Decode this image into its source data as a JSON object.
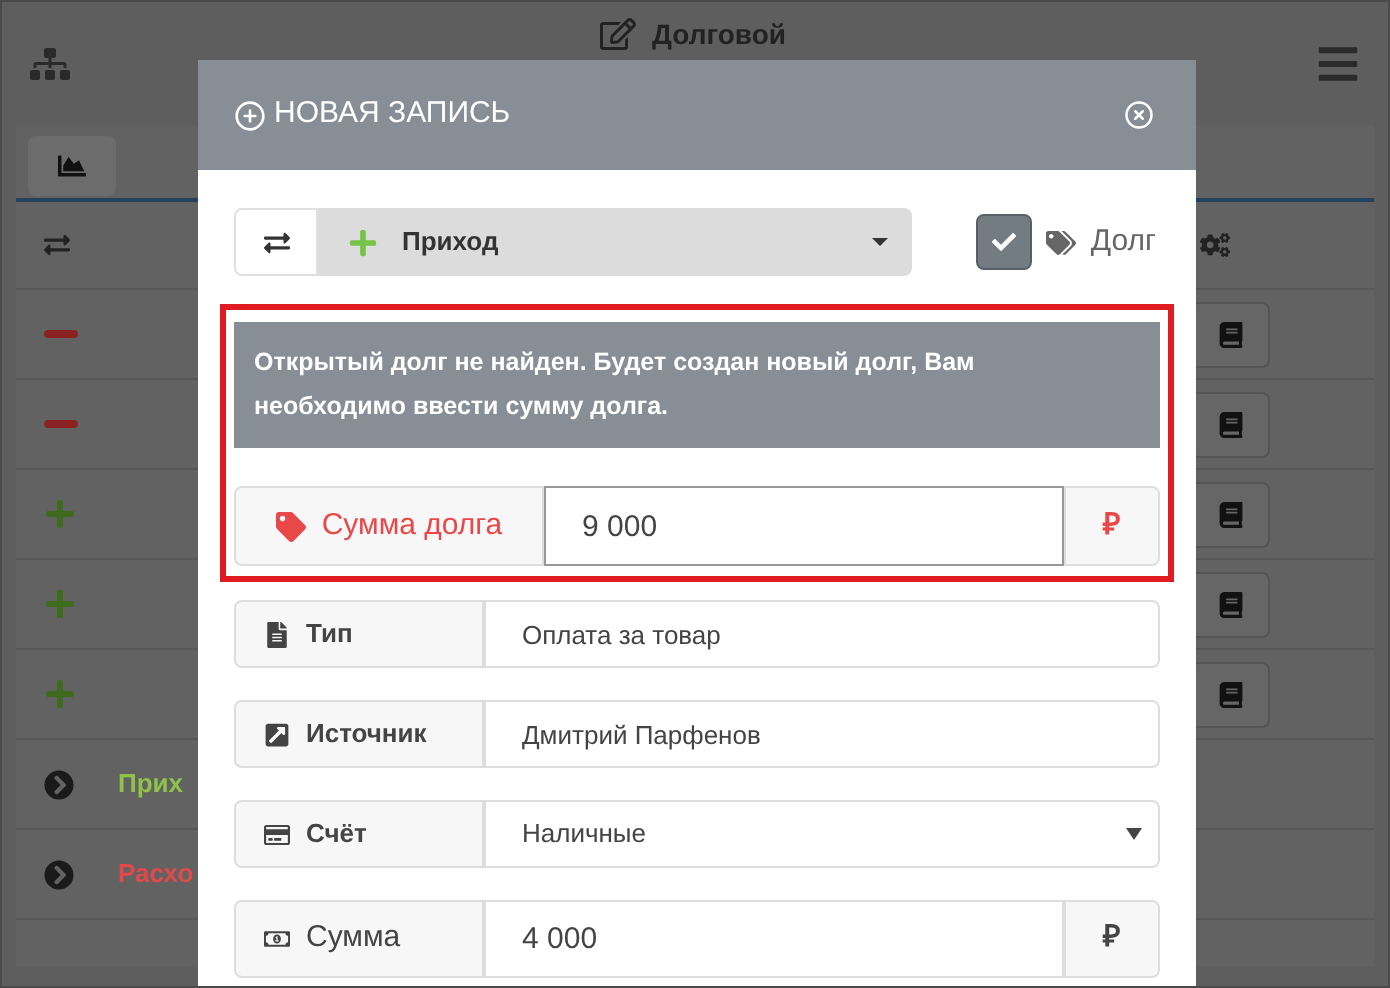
{
  "background": {
    "header_title": "Долговой",
    "rows": [
      {
        "kind": "minus"
      },
      {
        "kind": "minus"
      },
      {
        "kind": "plus"
      },
      {
        "kind": "plus"
      },
      {
        "kind": "plus"
      }
    ],
    "summary": [
      {
        "label": "Прих",
        "kind": "income"
      },
      {
        "label": "Расхо",
        "kind": "expense"
      }
    ]
  },
  "modal": {
    "title": "НОВАЯ ЗАПИСЬ",
    "type_select": {
      "value": "Приход"
    },
    "debt_checkbox": {
      "label": "Долг",
      "checked": true
    },
    "alert": "Открытый долг не найден. Будет создан новый долг, Вам необходимо ввести сумму долга.",
    "debt_amount": {
      "label": "Сумма долга",
      "value": "9 000",
      "currency": "₽"
    },
    "fields": [
      {
        "kind": "input",
        "label": "Тип",
        "value": "Оплата за товар"
      },
      {
        "kind": "input",
        "label": "Источник",
        "value": "Дмитрий Парфенов"
      },
      {
        "kind": "select",
        "label": "Счёт",
        "value": "Наличные"
      },
      {
        "kind": "amount",
        "label": "Сумма",
        "value": "4 000",
        "currency": "₽"
      }
    ]
  }
}
